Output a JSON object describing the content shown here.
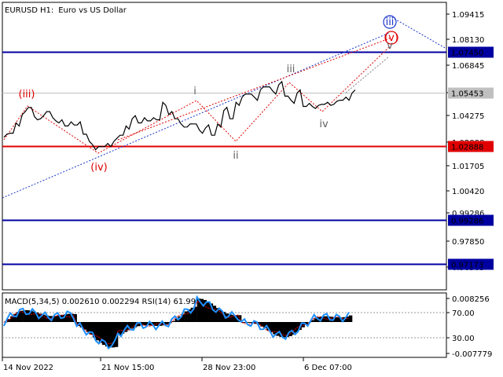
{
  "header": {
    "symbol": "EURUSD",
    "timeframe": "H1:",
    "description": "Euro vs US Dollar"
  },
  "colors": {
    "price_line": "#000000",
    "resistance": "#0000a0",
    "support": "#e00000",
    "wave_red": "#e00000",
    "wave_blue": "#1a35c8",
    "wave_grey": "#606060",
    "current_price_bg": "#c0c0c0",
    "macd_signal": "#e00000",
    "rsi": "#1e90ff"
  },
  "price_axis": {
    "ticks": [
      "1.09415",
      "1.08130",
      "1.06845",
      "1.05453",
      "1.04275",
      "1.02888",
      "1.01705",
      "1.00420",
      "0.99286",
      "0.97850",
      "0.96565"
    ]
  },
  "levels": [
    {
      "name": "level-1-07450",
      "label": "1.07450",
      "value": 1.0745,
      "color": "#0000a0",
      "style": "resistance"
    },
    {
      "name": "level-1-02888",
      "label": "1.02888",
      "value": 1.02888,
      "color": "#e00000",
      "style": "support"
    },
    {
      "name": "level-0-99286",
      "label": "0.99286",
      "value": 0.99286,
      "color": "#0000a0",
      "style": "resistance"
    },
    {
      "name": "level-0-97173",
      "label": "0.97173",
      "value": 0.97173,
      "color": "#0000a0",
      "style": "resistance"
    }
  ],
  "current_price": {
    "label": "1.05453",
    "value": 1.05453
  },
  "wave_labels": [
    {
      "name": "wave-label-iii-paren",
      "text": "(iii)",
      "color": "#e00000",
      "circled": false
    },
    {
      "name": "wave-label-iv-paren",
      "text": "(iv)",
      "color": "#e00000",
      "circled": false
    },
    {
      "name": "wave-label-v-paren",
      "text": "(v)",
      "color": "#e00000",
      "circled": true
    },
    {
      "name": "wave-label-iii-circled",
      "text": "iii",
      "color": "#1a35c8",
      "circled": true
    },
    {
      "name": "wave-label-i",
      "text": "i",
      "color": "#606060",
      "circled": false
    },
    {
      "name": "wave-label-ii",
      "text": "ii",
      "color": "#606060",
      "circled": false
    },
    {
      "name": "wave-label-iii",
      "text": "iii",
      "color": "#606060",
      "circled": false
    },
    {
      "name": "wave-label-iv",
      "text": "iv",
      "color": "#606060",
      "circled": false
    },
    {
      "name": "wave-label-v",
      "text": "v",
      "color": "#606060",
      "circled": false
    }
  ],
  "indicator": {
    "title": "MACD(5,34,5) 0.002610 0.002294 RSI(14) 61.99",
    "ticks": [
      "0.008256",
      "70.00",
      "30.00",
      "-0.007779"
    ]
  },
  "time_axis": {
    "labels": [
      "14 Nov 2022",
      "21 Nov 15:00",
      "28 Nov 23:00",
      "6 Dec 07:00"
    ]
  },
  "chart_data": {
    "type": "line",
    "title": "EURUSD, H1:  Euro vs US Dollar",
    "ylim": [
      0.959,
      1.0985
    ],
    "x": [
      "14 Nov 2022",
      "21 Nov 15:00",
      "28 Nov 23:00",
      "6 Dec 07:00"
    ],
    "series": [
      {
        "values": [
          1.033,
          1.035,
          1.04,
          1.044,
          1.0475,
          1.043,
          1.042,
          1.0455,
          1.0425,
          1.04,
          1.0385,
          1.0405,
          1.039,
          1.0345,
          1.031,
          1.027,
          1.0285,
          1.03,
          1.031,
          1.034,
          1.0385,
          1.042,
          1.04,
          1.0425,
          1.041,
          1.0415,
          1.05,
          1.044,
          1.042,
          1.0395,
          1.038,
          1.0395,
          1.0365,
          1.0375,
          1.034,
          1.0395,
          1.046,
          1.042,
          1.05,
          1.0525,
          1.054,
          1.0525,
          1.056,
          1.0575,
          1.0555,
          1.0585,
          1.053,
          1.051,
          1.0545,
          1.048,
          1.0495,
          1.047,
          1.049,
          1.05,
          1.049,
          1.051,
          1.0525,
          1.0545
        ]
      }
    ],
    "levels": [
      1.0745,
      1.02888,
      0.99286,
      0.97173
    ],
    "current_price": 1.05453,
    "indicator": {
      "macd": {
        "params": "5,34,5",
        "main": 0.00261,
        "signal": 0.002294,
        "ylim": [
          -0.007779,
          0.008256
        ]
      },
      "rsi": {
        "period": 14,
        "value": 61.99,
        "levels": [
          70,
          30
        ]
      }
    }
  }
}
